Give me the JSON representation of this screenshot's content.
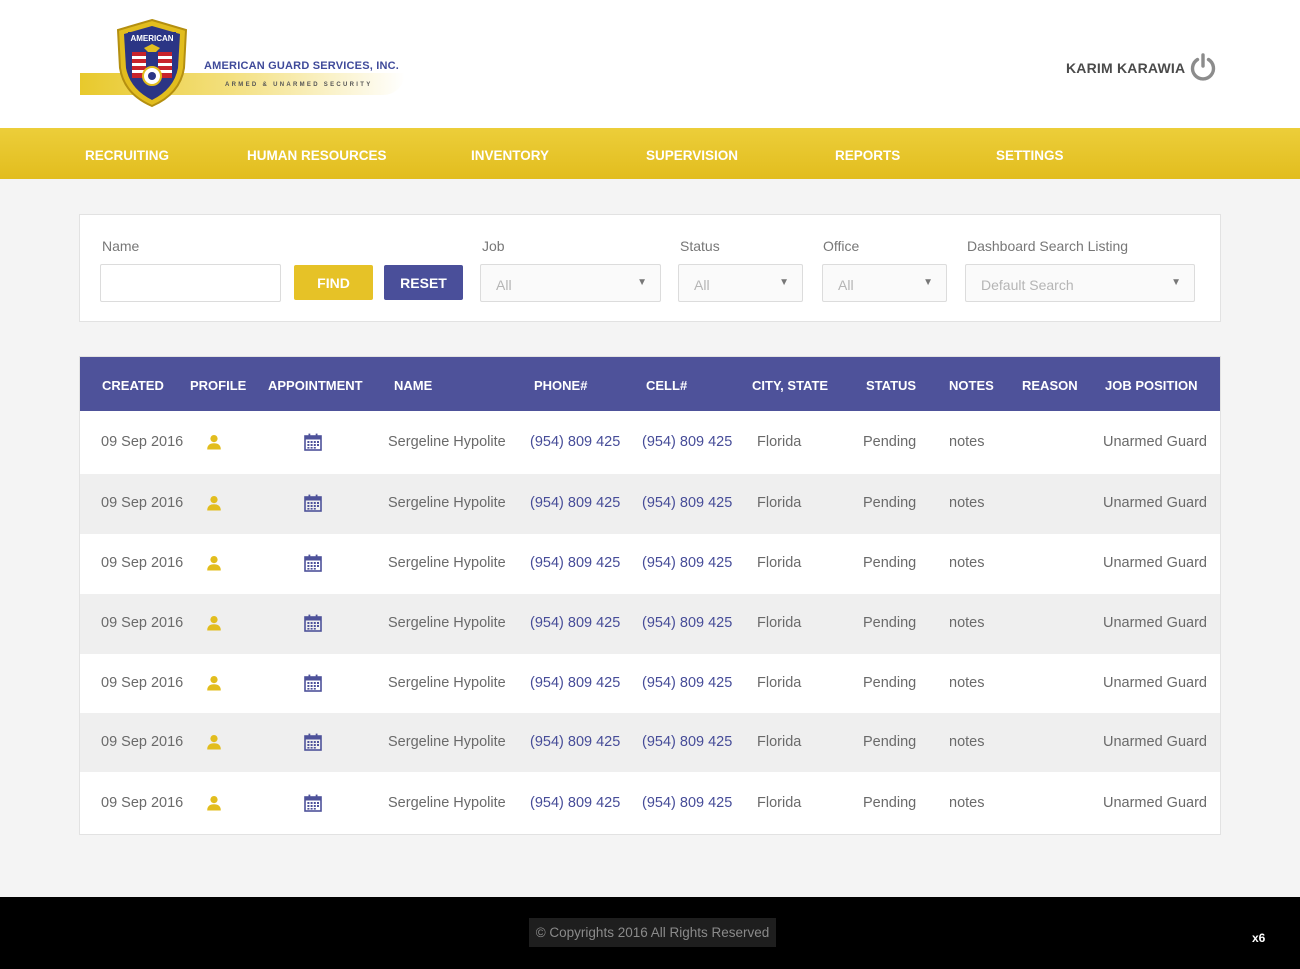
{
  "brand": {
    "company": "AMERICAN GUARD SERVICES, INC.",
    "tagline": "ARMED & UNARMED SECURITY",
    "shield_text": "AMERICAN",
    "colors": {
      "gold": "#e6c227",
      "navy": "#4e529a"
    }
  },
  "user": {
    "name": "KARIM KARAWIA",
    "logout_icon": "power-icon"
  },
  "nav": {
    "items": [
      {
        "label": "RECRUITING"
      },
      {
        "label": "HUMAN RESOURCES"
      },
      {
        "label": "INVENTORY"
      },
      {
        "label": "SUPERVISION"
      },
      {
        "label": "REPORTS"
      },
      {
        "label": "SETTINGS"
      }
    ]
  },
  "filters": {
    "name_label": "Name",
    "name_value": "",
    "find_label": "FIND",
    "reset_label": "RESET",
    "job": {
      "label": "Job",
      "value": "All"
    },
    "status": {
      "label": "Status",
      "value": "All"
    },
    "office": {
      "label": "Office",
      "value": "All"
    },
    "listing": {
      "label": "Dashboard Search Listing",
      "value": "Default Search"
    }
  },
  "table": {
    "columns": [
      "CREATED",
      "PROFILE",
      "APPOINTMENT",
      "NAME",
      "PHONE#",
      "CELL#",
      "CITY, STATE",
      "STATUS",
      "NOTES",
      "REASON",
      "JOB POSITION"
    ],
    "rows": [
      {
        "created": "09 Sep 2016",
        "name": "Sergeline Hypolite",
        "phone": "(954) 809 425",
        "cell": "(954) 809 425",
        "city": "Florida",
        "status": "Pending",
        "notes": "notes",
        "reason": "",
        "job": "Unarmed Guard"
      },
      {
        "created": "09 Sep 2016",
        "name": "Sergeline Hypolite",
        "phone": "(954) 809 425",
        "cell": "(954) 809 425",
        "city": "Florida",
        "status": "Pending",
        "notes": "notes",
        "reason": "",
        "job": "Unarmed Guard"
      },
      {
        "created": "09 Sep 2016",
        "name": "Sergeline Hypolite",
        "phone": "(954) 809 425",
        "cell": "(954) 809 425",
        "city": "Florida",
        "status": "Pending",
        "notes": "notes",
        "reason": "",
        "job": "Unarmed Guard"
      },
      {
        "created": "09 Sep 2016",
        "name": "Sergeline Hypolite",
        "phone": "(954) 809 425",
        "cell": "(954) 809 425",
        "city": "Florida",
        "status": "Pending",
        "notes": "notes",
        "reason": "",
        "job": "Unarmed Guard"
      },
      {
        "created": "09 Sep 2016",
        "name": "Sergeline Hypolite",
        "phone": "(954) 809 425",
        "cell": "(954) 809 425",
        "city": "Florida",
        "status": "Pending",
        "notes": "notes",
        "reason": "",
        "job": "Unarmed Guard"
      },
      {
        "created": "09 Sep 2016",
        "name": "Sergeline Hypolite",
        "phone": "(954) 809 425",
        "cell": "(954) 809 425",
        "city": "Florida",
        "status": "Pending",
        "notes": "notes",
        "reason": "",
        "job": "Unarmed Guard"
      },
      {
        "created": "09 Sep 2016",
        "name": "Sergeline Hypolite",
        "phone": "(954) 809 425",
        "cell": "(954) 809 425",
        "city": "Florida",
        "status": "Pending",
        "notes": "notes",
        "reason": "",
        "job": "Unarmed Guard"
      }
    ],
    "profile_icon": "user-icon",
    "appointment_icon": "calendar-icon"
  },
  "footer": {
    "copyright": "© Copyrights 2016  All Rights Reserved",
    "zoom": "x6"
  }
}
